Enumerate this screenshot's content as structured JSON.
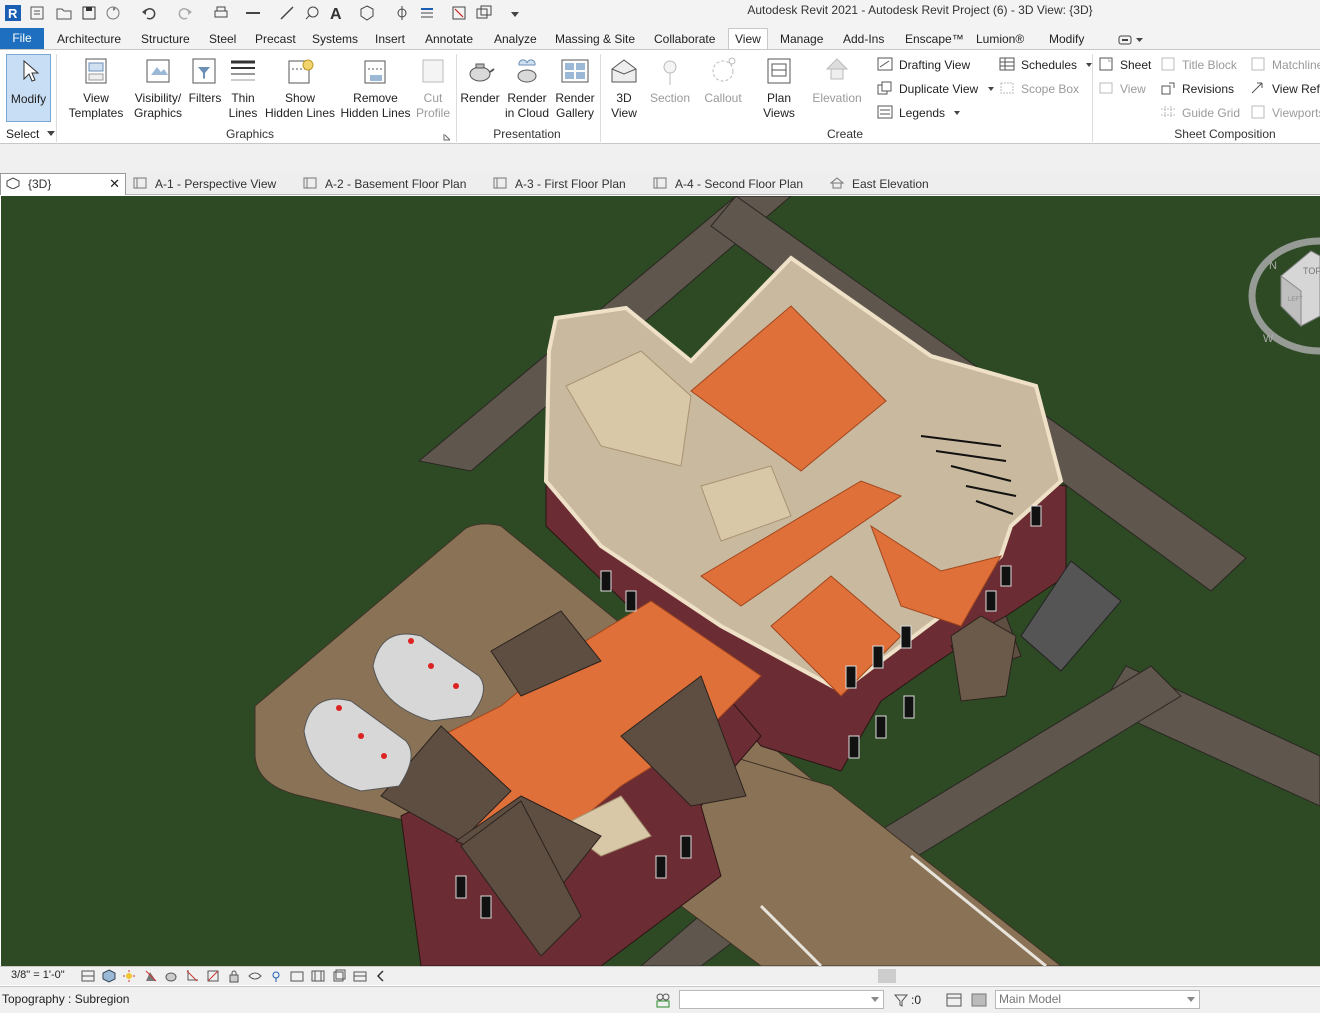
{
  "app": {
    "title": "Autodesk Revit 2021 - Autodesk Revit Project  (6) - 3D View: {3D}"
  },
  "quick_access": [
    "revit-logo-icon",
    "open-icon",
    "open-folder-icon",
    "save-icon",
    "sync-icon",
    "undo-icon",
    "redo-icon",
    "print-icon",
    "measure-icon",
    "dimension-icon",
    "tag-icon",
    "text-icon",
    "3d-view-icon",
    "section-icon",
    "thin-lines-icon",
    "close-hidden-icon",
    "switch-windows-icon",
    "customize-icon"
  ],
  "ribbon_tabs": [
    "File",
    "Architecture",
    "Structure",
    "Steel",
    "Precast",
    "Systems",
    "Insert",
    "Annotate",
    "Analyze",
    "Massing & Site",
    "Collaborate",
    "View",
    "Manage",
    "Add-Ins",
    "Enscape™",
    "Lumion®",
    "Modify"
  ],
  "active_tab": "View",
  "ribbon": {
    "select": {
      "modify": "Modify",
      "select": "Select"
    },
    "graphics": {
      "view_templates": [
        "View",
        "Templates"
      ],
      "visibility": [
        "Visibility/",
        "Graphics"
      ],
      "filters": [
        "Filters"
      ],
      "thin_lines": [
        "Thin",
        "Lines"
      ],
      "show_hidden": [
        "Show",
        "Hidden Lines"
      ],
      "remove_hidden": [
        "Remove",
        "Hidden Lines"
      ],
      "cut_profile": [
        "Cut",
        "Profile"
      ],
      "label": "Graphics"
    },
    "presentation": {
      "render": [
        "Render"
      ],
      "render_cloud": [
        "Render",
        "in Cloud"
      ],
      "render_gallery": [
        "Render",
        "Gallery"
      ],
      "label": "Presentation"
    },
    "create": {
      "view3d": [
        "3D",
        "View"
      ],
      "section": [
        "Section"
      ],
      "callout": [
        "Callout"
      ],
      "plan_views": [
        "Plan",
        "Views"
      ],
      "elevation": [
        "Elevation"
      ],
      "drafting_view": "Drafting  View",
      "duplicate_view": "Duplicate  View",
      "legends": "Legends",
      "schedules": "Schedules",
      "scope_box": "Scope  Box",
      "label": "Create"
    },
    "sheet_composition": {
      "sheet": "Sheet",
      "view": "View",
      "title_block": "Title  Block",
      "revisions": "Revisions",
      "guide_grid": "Guide  Grid",
      "matchline": "Matchline",
      "view_reference": "View  Refe",
      "viewports": "Viewports",
      "label": "Sheet Composition"
    }
  },
  "view_tabs": [
    {
      "label": "{3D}",
      "active": true
    },
    {
      "label": "A-1 - Perspective View"
    },
    {
      "label": "A-2 - Basement Floor Plan"
    },
    {
      "label": "A-3 - First Floor Plan"
    },
    {
      "label": "A-4 - Second Floor Plan"
    },
    {
      "label": "East Elevation"
    }
  ],
  "viewcube": {
    "top": "TOP",
    "left": "LEFT",
    "north": "N",
    "west": "W"
  },
  "view_control": {
    "scale": "3/8\" = 1'-0\""
  },
  "status": {
    "text": "Topography : Subregion",
    "filter_count": ":0",
    "model": "Main Model"
  },
  "colors": {
    "ground": "#2e4a24",
    "driveway": "#8a7256",
    "floor": "#e0703a",
    "brick": "#6b2d33",
    "roof": "#5e4e42",
    "ribbon_blue": "#1e6fbf"
  }
}
